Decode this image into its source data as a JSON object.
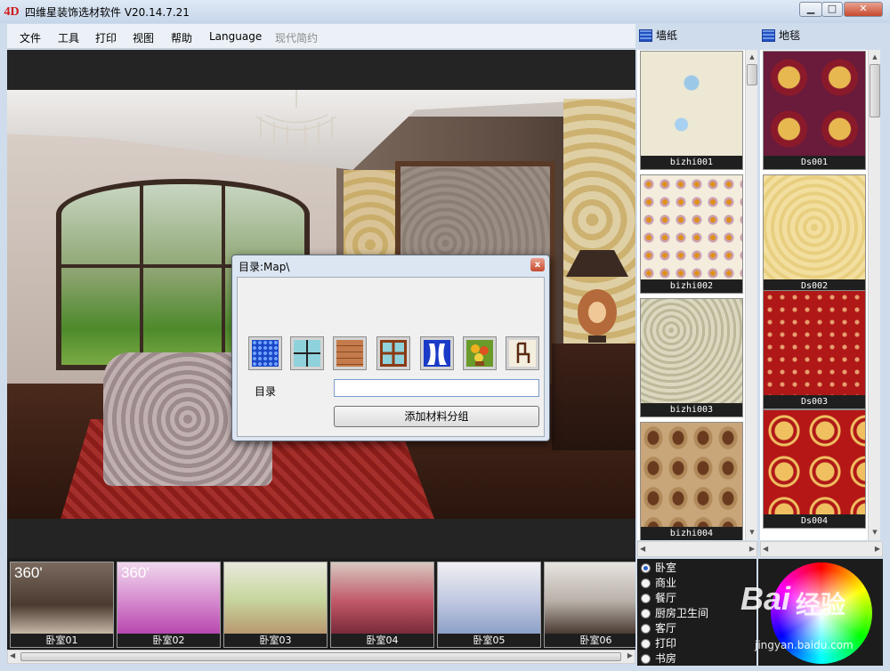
{
  "window": {
    "title": "四维星装饰选材软件 V20.14.7.21",
    "app_icon_text": "4D",
    "min_glyph": "▁",
    "max_glyph": "□",
    "close_glyph": "✕"
  },
  "menu": {
    "items": [
      "文件",
      "工具",
      "打印",
      "视图",
      "帮助",
      "Language"
    ],
    "style_label": "现代简约"
  },
  "categories": {
    "wallpaper_label": "墙纸",
    "carpet_label": "地毯"
  },
  "dialog": {
    "title": "目录:Map\\",
    "close_glyph": "x",
    "tools": [
      "blue-texture-icon",
      "cross-grid-icon",
      "wood-planks-icon",
      "window-frame-icon",
      "curtain-window-icon",
      "flower-painting-icon",
      "chair-icon"
    ],
    "dir_label": "目录",
    "dir_value": "",
    "add_group_label": "添加材料分组"
  },
  "wallpapers": [
    {
      "label": "bizhi001"
    },
    {
      "label": "bizhi002"
    },
    {
      "label": "bizhi003"
    },
    {
      "label": "bizhi004"
    }
  ],
  "carpets": [
    {
      "label": "Ds001"
    },
    {
      "label": "Ds002"
    },
    {
      "label": "Ds003"
    },
    {
      "label": "Ds004"
    }
  ],
  "scroll": {
    "up": "▲",
    "down": "▼",
    "left": "◀",
    "right": "▶"
  },
  "rooms": [
    {
      "label": "卧室01",
      "badge": "360'"
    },
    {
      "label": "卧室02",
      "badge": "360'"
    },
    {
      "label": "卧室03",
      "badge": ""
    },
    {
      "label": "卧室04",
      "badge": ""
    },
    {
      "label": "卧室05",
      "badge": ""
    },
    {
      "label": "卧室06",
      "badge": ""
    }
  ],
  "room_types": {
    "selected": "卧室",
    "items": [
      "卧室",
      "商业",
      "餐厅",
      "厨房卫生间",
      "客厅",
      "打印",
      "书房"
    ]
  },
  "watermark": {
    "brand": "Bai",
    "brand_cn": "经验",
    "url": "jingyan.baidu.com"
  },
  "colors": {
    "title_bar": "#c6d6ea",
    "viewport_bg": "#242424",
    "radio_selected": "#2e62c8"
  }
}
